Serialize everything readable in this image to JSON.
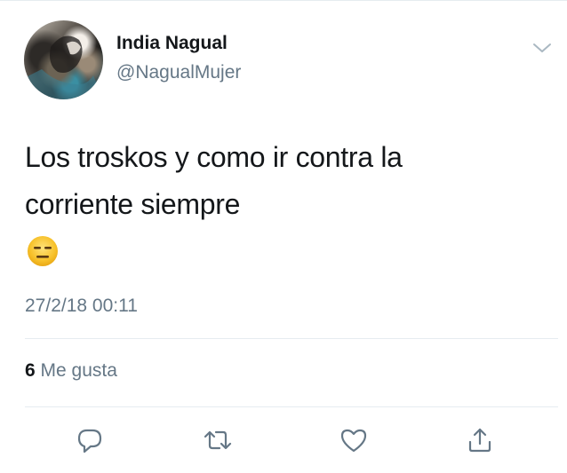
{
  "tweet": {
    "author": {
      "display_name": "India Nagual",
      "handle": "@NagualMujer"
    },
    "text_lines": [
      "Los troskos  y como ir contra la",
      "corriente siempre"
    ],
    "emoji": "expressionless-face",
    "timestamp": "27/2/18 00:11",
    "likes": {
      "count": "6",
      "label": "Me gusta"
    }
  },
  "actions": [
    {
      "name": "reply",
      "icon": "reply-icon"
    },
    {
      "name": "retweet",
      "icon": "retweet-icon"
    },
    {
      "name": "like",
      "icon": "heart-icon"
    },
    {
      "name": "share",
      "icon": "share-icon"
    }
  ],
  "colors": {
    "text_primary": "#14171a",
    "text_secondary": "#657786",
    "action_icon": "#657786",
    "divider": "#e6ecf0",
    "emoji_fill": "#f7c12a"
  }
}
